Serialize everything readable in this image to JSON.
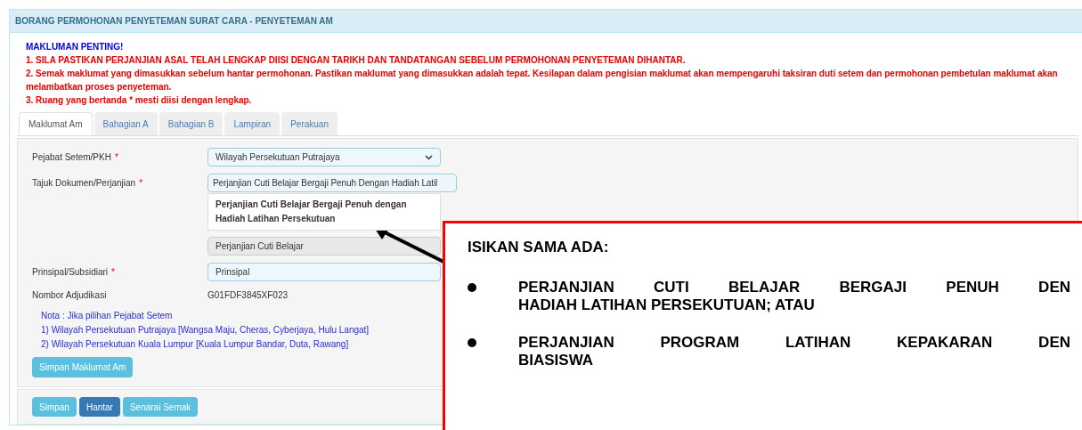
{
  "panel": {
    "title": "BORANG PERMOHONAN PENYETEMAN SURAT CARA - PENYETEMAN AM"
  },
  "notice": {
    "heading": "MAKLUMAN PENTING!",
    "items": [
      "1. SILA PASTIKAN PERJANJIAN ASAL TELAH LENGKAP DIISI DENGAN TARIKH DAN TANDATANGAN SEBELUM PERMOHONAN PENYETEMAN DIHANTAR.",
      "2. Semak maklumat yang dimasukkan sebelum hantar permohonan. Pastikan maklumat yang dimasukkan adalah tepat. Kesilapan dalam pengisian maklumat akan mempengaruhi taksiran duti setem dan permohonan pembetulan maklumat akan melambatkan proses penyeteman.",
      "3. Ruang yang bertanda  * mesti diisi dengan lengkap."
    ]
  },
  "tabs": [
    {
      "label": "Maklumat Am",
      "selected": true
    },
    {
      "label": "Bahagian A",
      "selected": false
    },
    {
      "label": "Bahagian B",
      "selected": false
    },
    {
      "label": "Lampiran",
      "selected": false
    },
    {
      "label": "Perakuan",
      "selected": false
    }
  ],
  "form": {
    "fields": [
      {
        "kind": "select",
        "label": "Pejabat Setem/PKH",
        "required_mark": "*",
        "value": "Wilayah Persekutuan Putrajaya"
      },
      {
        "kind": "input",
        "label": "Tajuk Dokumen/Perjanjian",
        "required_mark": "*",
        "value": "Perjanjian Cuti Belajar Bergaji Penuh Dengan Hadiah Latil",
        "suggestion": "Perjanjian Cuti Belajar Bergaji Penuh dengan Hadiah Latihan Persekutuan"
      },
      {
        "kind": "readonly",
        "value": "Perjanjian Cuti Belajar"
      },
      {
        "kind": "input",
        "label": "Prinsipal/Subsidiari",
        "required_mark": "*",
        "value": "Prinsipal"
      },
      {
        "kind": "text",
        "label": "Nombor Adjudikasi",
        "value": "G01FDF3845XF023"
      }
    ],
    "notes": [
      "Nota : Jika pilihan Pejabat Setem",
      "1) Wilayah Persekutuan Putrajaya [Wangsa Maju, Cheras, Cyberjaya, Hulu Langat]",
      "2) Wilayah Persekutuan Kuala Lumpur [Kuala Lumpur Bandar, Duta, Rawang]"
    ],
    "save_button": "Simpan Maklumat Am"
  },
  "actions": [
    {
      "label": "Simpan",
      "kind": "info"
    },
    {
      "label": "Hantar",
      "kind": "primary"
    },
    {
      "label": "Senarai Semak",
      "kind": "info"
    }
  ],
  "callout": {
    "heading": "ISIKAN SAMA ADA:",
    "items": [
      {
        "lines": [
          "PERJANJIAN CUTI BELAJAR BERGAJI PENUH DEN",
          "HADIAH LATIHAN PERSEKUTUAN; ATAU"
        ]
      },
      {
        "lines": [
          "PERJANJIAN PROGRAM LATIHAN KEPAKARAN DEN",
          "BIASISWA"
        ]
      }
    ]
  }
}
